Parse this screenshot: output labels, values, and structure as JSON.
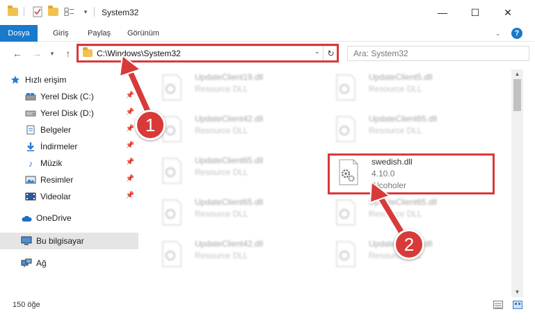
{
  "window": {
    "title": "System32",
    "minimize_glyph": "—",
    "maximize_glyph": "☐",
    "close_glyph": "✕"
  },
  "ribbon": {
    "tabs": [
      "Dosya",
      "Giriş",
      "Paylaş",
      "Görünüm"
    ],
    "help_glyph": "?"
  },
  "address": {
    "path": "C:\\Windows\\System32",
    "refresh_glyph": "↻"
  },
  "search": {
    "placeholder": "Ara: System32"
  },
  "sidebar": {
    "items": [
      {
        "label": "Hızlı erişim",
        "icon": "star-icon",
        "pinned": false
      },
      {
        "label": "Yerel Disk (C:)",
        "icon": "drive-icon",
        "pinned": true
      },
      {
        "label": "Yerel Disk (D:)",
        "icon": "drive-icon",
        "pinned": true
      },
      {
        "label": "Belgeler",
        "icon": "document-icon",
        "pinned": true
      },
      {
        "label": "İndirmeler",
        "icon": "download-icon",
        "pinned": true
      },
      {
        "label": "Müzik",
        "icon": "music-icon",
        "pinned": true
      },
      {
        "label": "Resimler",
        "icon": "pictures-icon",
        "pinned": true
      },
      {
        "label": "Videolar",
        "icon": "video-icon",
        "pinned": true
      },
      {
        "label": "OneDrive",
        "icon": "cloud-icon",
        "pinned": false
      },
      {
        "label": "Bu bilgisayar",
        "icon": "computer-icon",
        "pinned": false
      },
      {
        "label": "Ağ",
        "icon": "network-icon",
        "pinned": false
      }
    ]
  },
  "files": {
    "left": [
      {
        "name": "UpdateClient19.dll",
        "sub": "Resource DLL"
      },
      {
        "name": "UpdateClient42.dll",
        "sub": "Resource DLL"
      },
      {
        "name": "UpdateClient65.dll",
        "sub": "Resource DLL"
      },
      {
        "name": "UpdateClient65.dll",
        "sub": "Resource DLL"
      },
      {
        "name": "UpdateClient42.dll",
        "sub": "Resource DLL"
      }
    ],
    "right": [
      {
        "name": "UpdateClient5.dll",
        "sub": "Resource DLL"
      },
      {
        "name": "UpdateClient65.dll",
        "sub": "Resource DLL"
      },
      {
        "name": "UpdateClient65.dll",
        "sub": "Resource DLL"
      },
      {
        "name": "UpdateClient5.dll",
        "sub": "Resource DLL"
      }
    ],
    "highlighted": {
      "name": "swedish.dll",
      "version": "4.10.0",
      "company": "Alcoholer"
    }
  },
  "status": {
    "item_count": "150 öğe"
  },
  "annotations": {
    "marker_1": "1",
    "marker_2": "2",
    "color": "#d83a3a"
  }
}
